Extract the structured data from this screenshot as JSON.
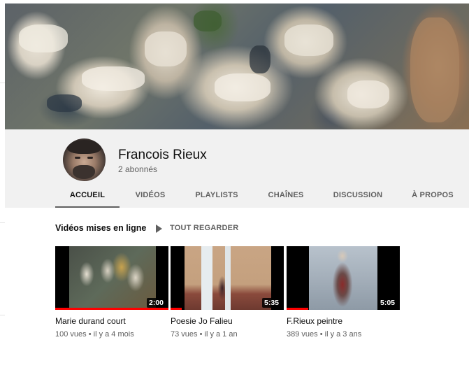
{
  "channel": {
    "name": "Francois Rieux",
    "subscribers": "2 abonnés"
  },
  "tabs": [
    {
      "label": "ACCUEIL",
      "active": true
    },
    {
      "label": "VIDÉOS",
      "active": false
    },
    {
      "label": "PLAYLISTS",
      "active": false
    },
    {
      "label": "CHAÎNES",
      "active": false
    },
    {
      "label": "DISCUSSION",
      "active": false
    },
    {
      "label": "À PROPOS",
      "active": false
    }
  ],
  "section": {
    "title": "Vidéos mises en ligne",
    "play_all_label": "TOUT REGARDER",
    "play_icon": "play-icon"
  },
  "videos": [
    {
      "title": "Marie durand court",
      "views": "100 vues",
      "age": "il y a 4 mois",
      "duration": "2:00",
      "watched_fraction": 1.0
    },
    {
      "title": "Poesie Jo Falieu",
      "views": "73 vues",
      "age": "il y a 1 an",
      "duration": "5:35",
      "watched_fraction": 0.1
    },
    {
      "title": "F.Rieux peintre",
      "views": "389 vues",
      "age": "il y a 3 ans",
      "duration": "5:05",
      "watched_fraction": 0.19
    }
  ],
  "meta_separator": " • ",
  "colors": {
    "accent": "#ff0000",
    "header_bg": "#f1f1f1",
    "tab_text": "#606060"
  }
}
